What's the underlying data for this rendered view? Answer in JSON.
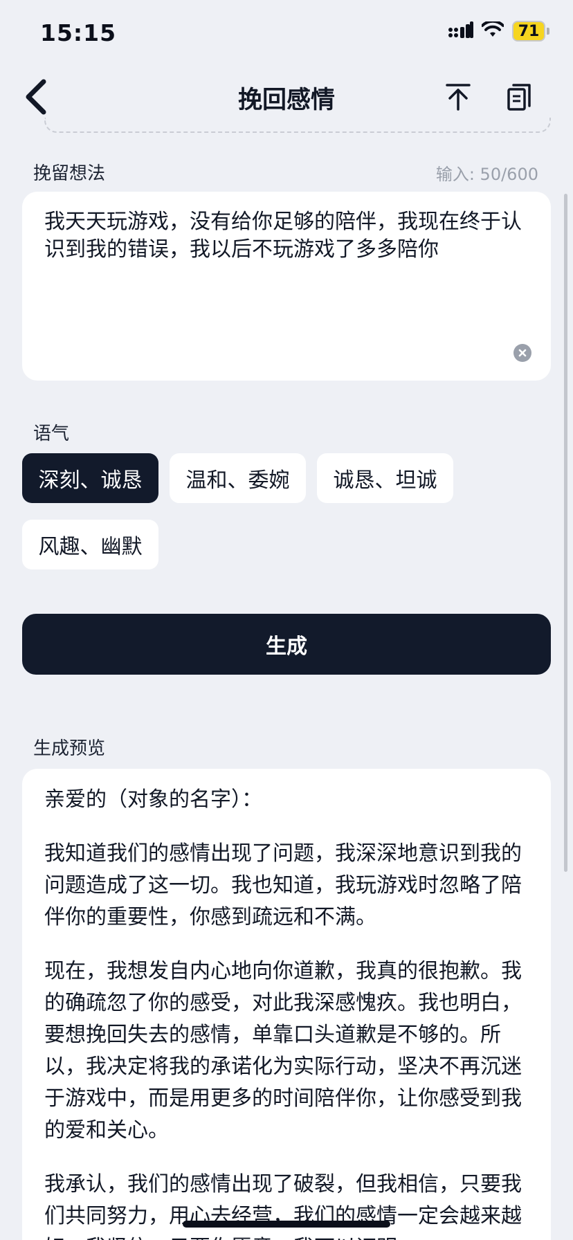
{
  "status_bar": {
    "time": "15:15",
    "battery": "71"
  },
  "nav": {
    "title": "挽回感情"
  },
  "retain": {
    "label": "挽留想法",
    "counter": "输入: 50/600",
    "text": "我天天玩游戏，没有给你足够的陪伴，我现在终于认识到我的错误，我以后不玩游戏了多多陪你"
  },
  "tone": {
    "label": "语气",
    "options": [
      "深刻、诚恳",
      "温和、委婉",
      "诚恳、坦诚",
      "风趣、幽默"
    ],
    "selected": "深刻、诚恳"
  },
  "generate": {
    "label": "生成"
  },
  "preview": {
    "label": "生成预览",
    "paragraphs": [
      "亲爱的（对象的名字）：",
      "我知道我们的感情出现了问题，我深深地意识到我的问题造成了这一切。我也知道，我玩游戏时忽略了陪伴你的重要性，你感到疏远和不满。",
      "现在，我想发自内心地向你道歉，我真的很抱歉。我的确疏忽了你的感受，对此我深感愧疚。我也明白，要想挽回失去的感情，单靠口头道歉是不够的。所以，我决定将我的承诺化为实际行动，坚决不再沉迷于游戏中，而是用更多的时间陪伴你，让你感受到我的爱和关心。",
      "我承认，我们的感情出现了破裂，但我相信，只要我们共同努力，用心去经营，我们的感情一定会越来越好。我坚信，只要你愿意，我可以证明"
    ]
  },
  "colors": {
    "background": "#eef0f5",
    "dark": "#121a2b",
    "card": "#ffffff",
    "muted": "#9aa0ab",
    "battery": "#f6d51f"
  }
}
